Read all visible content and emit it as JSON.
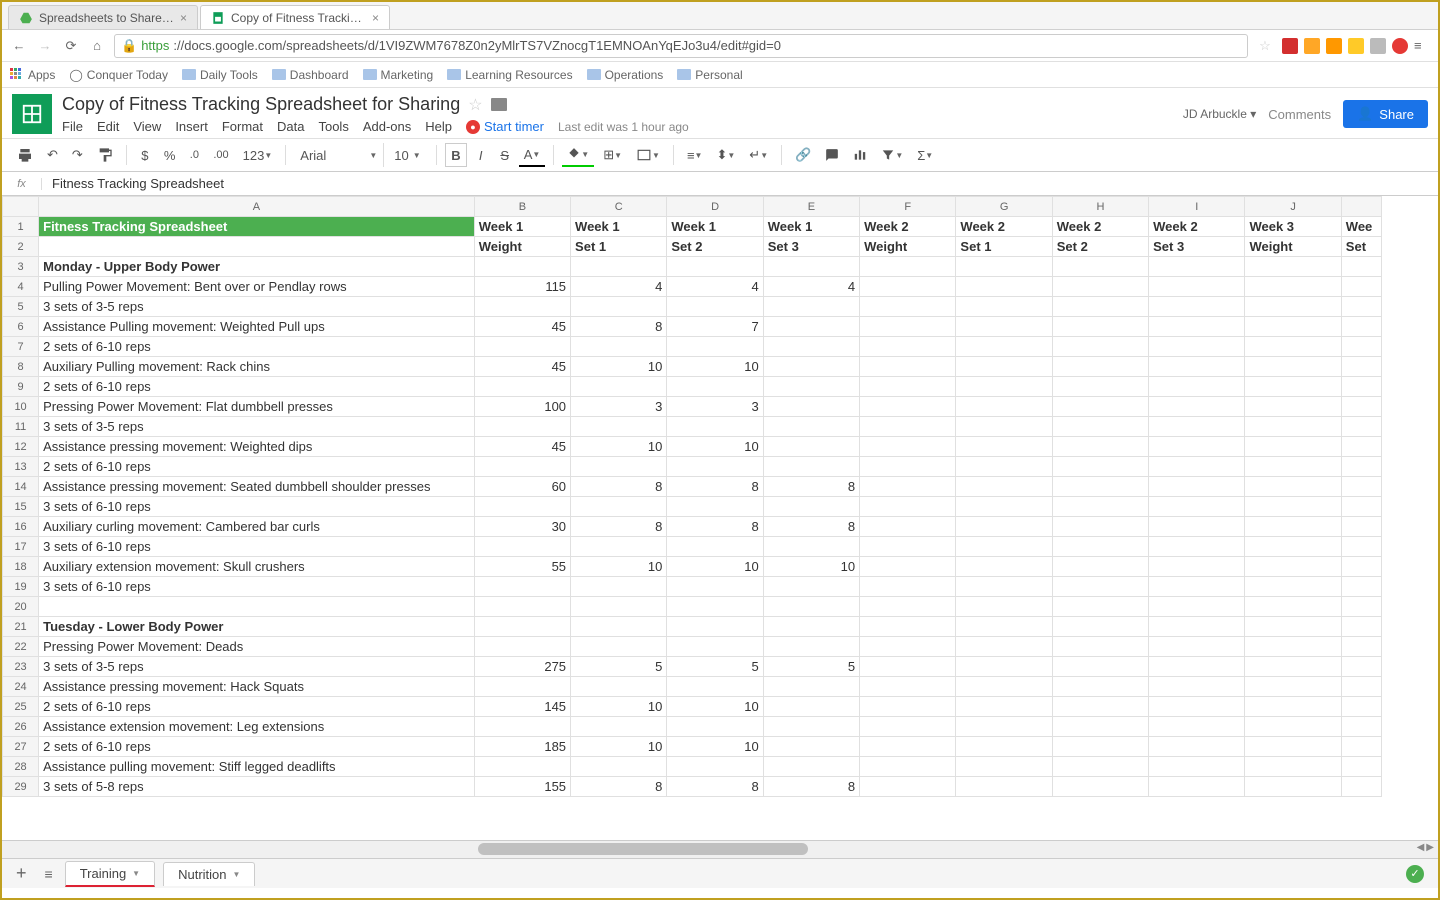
{
  "browser": {
    "tabs": [
      {
        "title": "Spreadsheets to Share fo…"
      },
      {
        "title": "Copy of Fitness Tracking …"
      }
    ],
    "url_proto": "https",
    "url_rest": "://docs.google.com/spreadsheets/d/1VI9ZWM7678Z0n2yMlrTS7VZnocgT1EMNOAnYqEJo3u4/edit#gid=0",
    "bookmarks": [
      "Apps",
      "Conquer Today",
      "Daily Tools",
      "Dashboard",
      "Marketing",
      "Learning Resources",
      "Operations",
      "Personal"
    ]
  },
  "doc": {
    "title": "Copy of Fitness Tracking Spreadsheet for Sharing",
    "menus": [
      "File",
      "Edit",
      "View",
      "Insert",
      "Format",
      "Data",
      "Tools",
      "Add-ons",
      "Help"
    ],
    "timer_label": "Start timer",
    "last_edit": "Last edit was 1 hour ago",
    "user": "JD Arbuckle",
    "comments": "Comments",
    "share": "Share"
  },
  "toolbar": {
    "font": "Arial",
    "size": "10",
    "fmt": [
      "$",
      "%",
      ".0",
      ".00",
      "123"
    ]
  },
  "fx": {
    "label": "fx",
    "value": "Fitness Tracking Spreadsheet"
  },
  "columns": [
    "A",
    "B",
    "C",
    "D",
    "E",
    "F",
    "G",
    "H",
    "I",
    "J"
  ],
  "partial_col": "We",
  "rows": [
    {
      "n": 1,
      "a": "Fitness Tracking Spreadsheet",
      "b": "Week 1",
      "c": "Week 1",
      "d": "Week 1",
      "e": "Week 1",
      "f": "Week 2",
      "g": "Week 2",
      "h": "Week 2",
      "i": "Week 2",
      "j": "Week 3",
      "k": "Wee",
      "title": true,
      "header": true
    },
    {
      "n": 2,
      "a": "",
      "b": "Weight",
      "c": "Set 1",
      "d": "Set 2",
      "e": "Set 3",
      "f": "Weight",
      "g": "Set 1",
      "h": "Set 2",
      "i": "Set 3",
      "j": "Weight",
      "k": "Set",
      "header": true
    },
    {
      "n": 3,
      "a": "Monday - Upper Body Power",
      "bold": true
    },
    {
      "n": 4,
      "a": "Pulling Power Movement: Bent over or Pendlay rows",
      "b": "115",
      "c": "4",
      "d": "4",
      "e": "4"
    },
    {
      "n": 5,
      "a": "3 sets of 3-5 reps"
    },
    {
      "n": 6,
      "a": "Assistance Pulling movement: Weighted Pull ups",
      "b": "45",
      "c": "8",
      "d": "7"
    },
    {
      "n": 7,
      "a": "2 sets of 6-10 reps"
    },
    {
      "n": 8,
      "a": "Auxiliary Pulling movement: Rack chins",
      "b": "45",
      "c": "10",
      "d": "10"
    },
    {
      "n": 9,
      "a": "2 sets of 6-10 reps"
    },
    {
      "n": 10,
      "a": "Pressing Power Movement: Flat dumbbell presses",
      "b": "100",
      "c": "3",
      "d": "3"
    },
    {
      "n": 11,
      "a": "3 sets of 3-5 reps"
    },
    {
      "n": 12,
      "a": "Assistance pressing movement: Weighted dips",
      "b": "45",
      "c": "10",
      "d": "10"
    },
    {
      "n": 13,
      "a": "2 sets of 6-10 reps"
    },
    {
      "n": 14,
      "a": "Assistance pressing movement: Seated dumbbell shoulder presses",
      "b": "60",
      "c": "8",
      "d": "8",
      "e": "8"
    },
    {
      "n": 15,
      "a": "3 sets of 6-10 reps"
    },
    {
      "n": 16,
      "a": "Auxiliary curling movement: Cambered bar curls",
      "b": "30",
      "c": "8",
      "d": "8",
      "e": "8"
    },
    {
      "n": 17,
      "a": "3 sets of 6-10 reps"
    },
    {
      "n": 18,
      "a": "Auxiliary extension movement: Skull crushers",
      "b": "55",
      "c": "10",
      "d": "10",
      "e": "10"
    },
    {
      "n": 19,
      "a": "3 sets of 6-10 reps"
    },
    {
      "n": 20,
      "a": ""
    },
    {
      "n": 21,
      "a": "Tuesday - Lower Body Power",
      "bold": true
    },
    {
      "n": 22,
      "a": "Pressing Power Movement: Deads"
    },
    {
      "n": 23,
      "a": "3 sets of 3-5 reps",
      "b": "275",
      "c": "5",
      "d": "5",
      "e": "5"
    },
    {
      "n": 24,
      "a": "Assistance pressing movement: Hack Squats"
    },
    {
      "n": 25,
      "a": "2 sets of 6-10 reps",
      "b": "145",
      "c": "10",
      "d": "10"
    },
    {
      "n": 26,
      "a": "Assistance extension movement: Leg extensions"
    },
    {
      "n": 27,
      "a": "2 sets of 6-10 reps",
      "b": "185",
      "c": "10",
      "d": "10"
    },
    {
      "n": 28,
      "a": "Assistance pulling movement: Stiff legged deadlifts"
    },
    {
      "n": 29,
      "a": "3 sets of 5-8 reps",
      "b": "155",
      "c": "8",
      "d": "8",
      "e": "8"
    }
  ],
  "sheet_tabs": [
    "Training",
    "Nutrition"
  ]
}
